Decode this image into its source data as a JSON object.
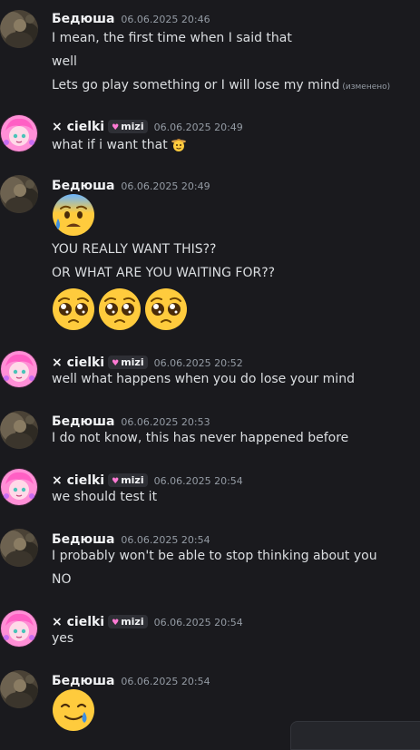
{
  "messages": [
    {
      "author": "Бедюша",
      "avatar": "bedusha-avatar",
      "timestamp": "06.06.2025 20:46",
      "lines": [
        "I mean, the first time when I said that",
        "well",
        "Lets go play something or I will lose my mind"
      ],
      "edited_label": "(изменено)"
    },
    {
      "author": "× cielki",
      "avatar": "cielki-avatar",
      "badge": "mizi",
      "timestamp": "06.06.2025 20:49",
      "lines": [
        "what if i want that"
      ],
      "inline_emoji": "cowboy-face-emoji"
    },
    {
      "author": "Бедюша",
      "avatar": "bedusha-avatar",
      "timestamp": "06.06.2025 20:49",
      "emoji": "anxious-face-with-sweat-emoji",
      "lines": [
        "YOU REALLY WANT THIS??",
        "OR WHAT ARE YOU WAITING FOR??"
      ],
      "emoji_row": [
        "pleading-face-emoji",
        "pleading-face-emoji",
        "pleading-face-emoji"
      ]
    },
    {
      "author": "× cielki",
      "avatar": "cielki-avatar",
      "badge": "mizi",
      "timestamp": "06.06.2025 20:52",
      "lines": [
        "well what happens when you do lose your mind"
      ]
    },
    {
      "author": "Бедюша",
      "avatar": "bedusha-avatar",
      "timestamp": "06.06.2025 20:53",
      "lines": [
        "I do not know, this has never happened before"
      ]
    },
    {
      "author": "× cielki",
      "avatar": "cielki-avatar",
      "badge": "mizi",
      "timestamp": "06.06.2025 20:54",
      "lines": [
        "we should test it"
      ]
    },
    {
      "author": "Бедюша",
      "avatar": "bedusha-avatar",
      "timestamp": "06.06.2025 20:54",
      "lines": [
        "I probably won't be able to stop thinking about you",
        "NO"
      ]
    },
    {
      "author": "× cielki",
      "avatar": "cielki-avatar",
      "badge": "mizi",
      "timestamp": "06.06.2025 20:54",
      "lines": [
        "yes"
      ]
    },
    {
      "author": "Бедюша",
      "avatar": "bedusha-avatar",
      "timestamp": "06.06.2025 20:54",
      "emoji": "smiling-face-with-tear-emoji"
    }
  ],
  "colors": {
    "background": "#1a1a1e",
    "text": "#dbdee1",
    "muted": "#949ba4",
    "name": "#f2f3f5",
    "badge_heart": "#ff7ad4"
  }
}
